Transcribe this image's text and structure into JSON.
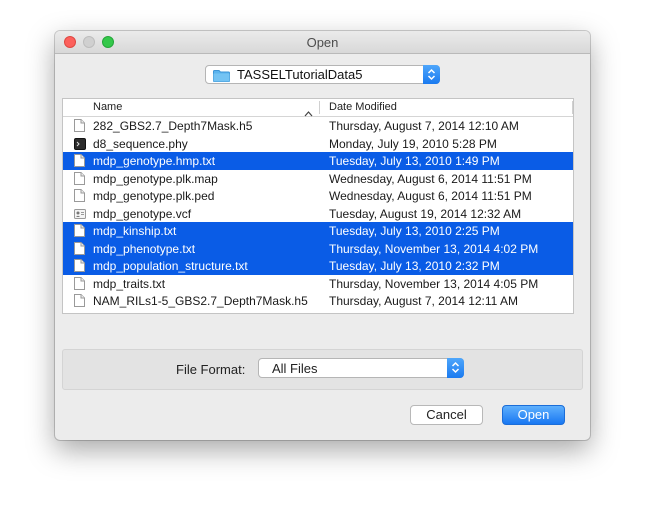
{
  "window": {
    "title": "Open"
  },
  "location": {
    "folder": "TASSELTutorialData5"
  },
  "columns": {
    "name": "Name",
    "date": "Date Modified"
  },
  "files": [
    {
      "name": "282_GBS2.7_Depth7Mask.h5",
      "date": "Thursday, August 7, 2014 12:10 AM",
      "selected": false,
      "icon": "document-icon"
    },
    {
      "name": "d8_sequence.phy",
      "date": "Monday, July 19, 2010 5:28 PM",
      "selected": false,
      "icon": "terminal-document-icon"
    },
    {
      "name": "mdp_genotype.hmp.txt",
      "date": "Tuesday, July 13, 2010 1:49 PM",
      "selected": true,
      "icon": "document-icon"
    },
    {
      "name": "mdp_genotype.plk.map",
      "date": "Wednesday, August 6, 2014 11:51 PM",
      "selected": false,
      "icon": "document-icon"
    },
    {
      "name": "mdp_genotype.plk.ped",
      "date": "Wednesday, August 6, 2014 11:51 PM",
      "selected": false,
      "icon": "document-icon"
    },
    {
      "name": "mdp_genotype.vcf",
      "date": "Tuesday, August 19, 2014 12:32 AM",
      "selected": false,
      "icon": "vcard-document-icon"
    },
    {
      "name": "mdp_kinship.txt",
      "date": "Tuesday, July 13, 2010 2:25 PM",
      "selected": true,
      "icon": "document-icon"
    },
    {
      "name": "mdp_phenotype.txt",
      "date": "Thursday, November 13, 2014 4:02 PM",
      "selected": true,
      "icon": "document-icon"
    },
    {
      "name": "mdp_population_structure.txt",
      "date": "Tuesday, July 13, 2010 2:32 PM",
      "selected": true,
      "icon": "document-icon"
    },
    {
      "name": "mdp_traits.txt",
      "date": "Thursday, November 13, 2014 4:05 PM",
      "selected": false,
      "icon": "document-icon"
    },
    {
      "name": "NAM_RILs1-5_GBS2.7_Depth7Mask.h5",
      "date": "Thursday, August 7, 2014 12:11 AM",
      "selected": false,
      "icon": "document-icon"
    }
  ],
  "format": {
    "label": "File Format:",
    "value": "All Files"
  },
  "buttons": {
    "cancel": "Cancel",
    "open": "Open"
  },
  "colors": {
    "selection": "#0a5ce6",
    "accent": "#1a7af0",
    "folder": "#4aa8e8"
  }
}
